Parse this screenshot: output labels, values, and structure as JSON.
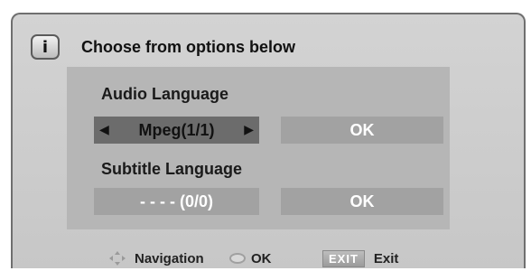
{
  "dialog": {
    "info_icon_glyph": "i",
    "title": "Choose from options below"
  },
  "audio": {
    "label": "Audio Language",
    "value": "Mpeg(1/1)",
    "left_arrow": "◀",
    "right_arrow": "▶",
    "ok_label": "OK"
  },
  "subtitle": {
    "label": "Subtitle Language",
    "value": "- - - - (0/0)",
    "ok_label": "OK"
  },
  "footer": {
    "navigation_label": "Navigation",
    "ok_label": "OK",
    "exit_key": "EXIT",
    "exit_label": "Exit"
  },
  "icons": {
    "info": "info-icon",
    "navigation": "dpad-icon",
    "ok": "ok-button-icon"
  },
  "colors": {
    "dialog_bg": "#cdcdcd",
    "panel_bg": "#b6b6b6",
    "active_selector": "#6c6c6c",
    "inactive_box": "#a2a2a2"
  }
}
